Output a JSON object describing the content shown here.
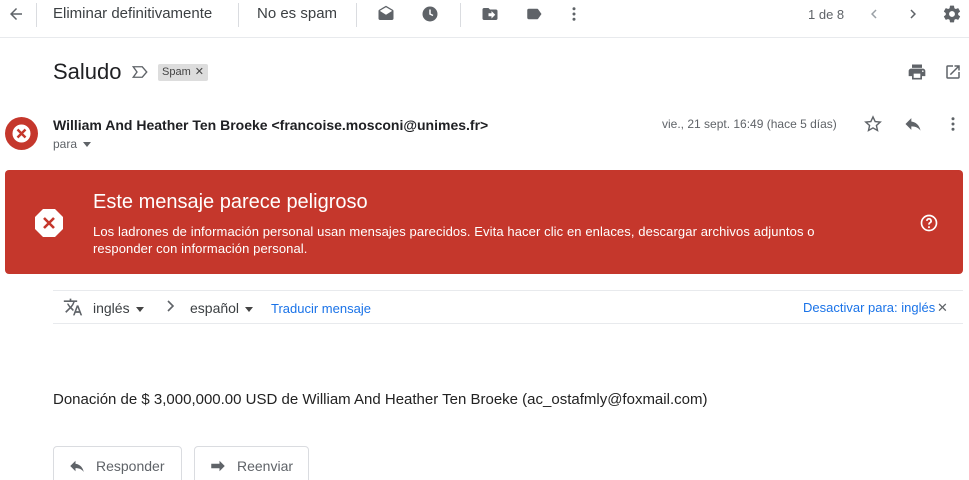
{
  "toolbar": {
    "delete_forever_label": "Eliminar definitivamente",
    "not_spam_label": "No es spam",
    "page_count": "1 de 8"
  },
  "message": {
    "subject": "Saludo",
    "label_chip": "Spam",
    "sender": "William And Heather Ten Broeke <francoise.mosconi@unimes.fr>",
    "to_label": "para",
    "date": "vie., 21 sept. 16:49 (hace 5 días)",
    "body": "Donación de $ 3,000,000.00 USD de William And Heather Ten Broeke (ac_ostafmly@foxmail.com)"
  },
  "warning": {
    "title": "Este mensaje parece peligroso",
    "text": "Los ladrones de información personal usan mensajes parecidos. Evita hacer clic en enlaces, descargar archivos adjuntos o responder con información personal.",
    "color": "#c5372c"
  },
  "translate": {
    "from_lang": "inglés",
    "to_lang": "español",
    "translate_link": "Traducir mensaje",
    "disable_link": "Desactivar para: inglés"
  },
  "actions": {
    "reply_label": "Responder",
    "forward_label": "Reenviar"
  },
  "icons": [
    "back-arrow-icon",
    "mail-icon",
    "clock-icon",
    "move-to-icon",
    "label-icon",
    "more-vert-icon",
    "chevron-left-icon",
    "chevron-right-icon",
    "settings-icon",
    "important-marker-icon",
    "print-icon",
    "open-new-window-icon",
    "danger-avatar-icon",
    "star-icon",
    "reply-icon",
    "danger-octagon-icon",
    "help-icon",
    "translate-icon",
    "close-icon",
    "forward-icon"
  ]
}
